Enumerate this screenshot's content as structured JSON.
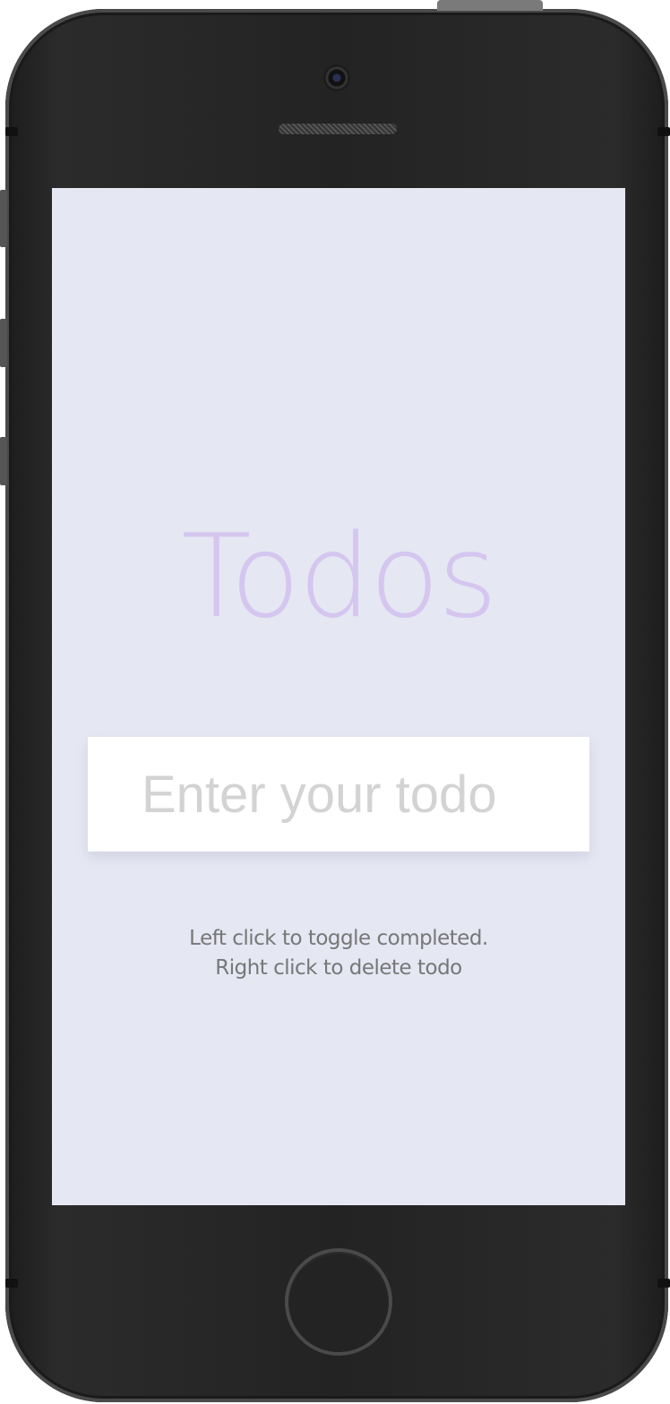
{
  "app": {
    "title": "Todos"
  },
  "input": {
    "placeholder": "Enter your todo",
    "value": ""
  },
  "instructions": {
    "line1": "Left click to toggle completed.",
    "line2": "Right click to delete todo"
  },
  "colors": {
    "screen_background": "#e5e7f3",
    "title": "#d5c6ef",
    "device_body": "#232323",
    "input_background": "#ffffff",
    "placeholder": "#d3d3d3",
    "hint_text": "#777777"
  },
  "device": {
    "icons": [
      "camera-icon",
      "speaker-grille-icon",
      "home-button-icon"
    ]
  }
}
